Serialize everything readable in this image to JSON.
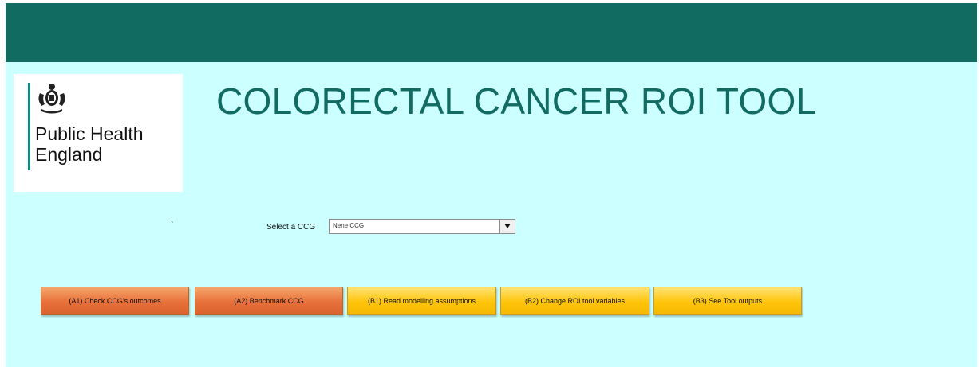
{
  "logo": {
    "crest_icon": "royal-coat-of-arms-icon",
    "line1": "Public Health",
    "line2": "England"
  },
  "header": {
    "title": "COLORECTAL CANCER ROI TOOL"
  },
  "stray_mark": "`",
  "ccg_selector": {
    "label": "Select a CCG",
    "value": "Nene CCG",
    "dropdown_icon": "dropdown-arrow-icon"
  },
  "buttons": [
    {
      "label": "(A1) Check CCG's outcomes"
    },
    {
      "label": "(A2) Benchmark CCG"
    },
    {
      "label": "(B1) Read modelling assumptions"
    },
    {
      "label": "(B2) Change ROI tool variables"
    },
    {
      "label": "(B3) See Tool outputs"
    }
  ],
  "colors": {
    "banner": "#126b60",
    "background": "#ccffff",
    "title": "#126b60",
    "button_a": "#e8703a",
    "button_b": "#ffc40a"
  }
}
